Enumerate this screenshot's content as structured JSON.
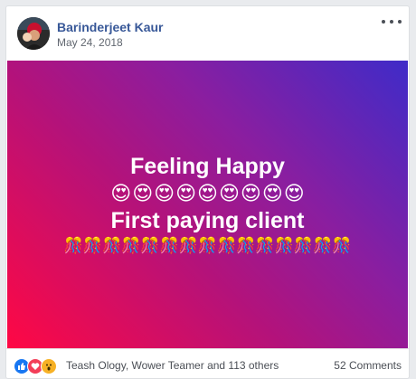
{
  "post": {
    "author": "Barinderjeet Kaur",
    "date": "May 24, 2018",
    "background_colors": [
      "#ff0844",
      "#b4127a",
      "#8a1ea0",
      "#3f2bc8"
    ],
    "line1": "Feeling Happy",
    "emoji_row_1": [
      "😍",
      "😍",
      "😍",
      "😍",
      "😍",
      "😍",
      "😍",
      "😍",
      "😍"
    ],
    "line2": "First paying client",
    "emoji_row_2": [
      "🎊",
      "🎊",
      "🎊",
      "🎊",
      "🎊",
      "🎊",
      "🎊",
      "🎊",
      "🎊",
      "🎊",
      "🎊",
      "🎊",
      "🎊",
      "🎊",
      "🎊"
    ]
  },
  "footer": {
    "reaction_icons": [
      "like-icon",
      "love-icon",
      "wow-icon"
    ],
    "reactors_text": "Teash Ology, Wower Teamer and 113 others",
    "comments_text": "52 Comments"
  },
  "colors": {
    "author": "#385898",
    "like": "#1877f2",
    "love": "#f33e58",
    "wow": "#f7b125"
  }
}
